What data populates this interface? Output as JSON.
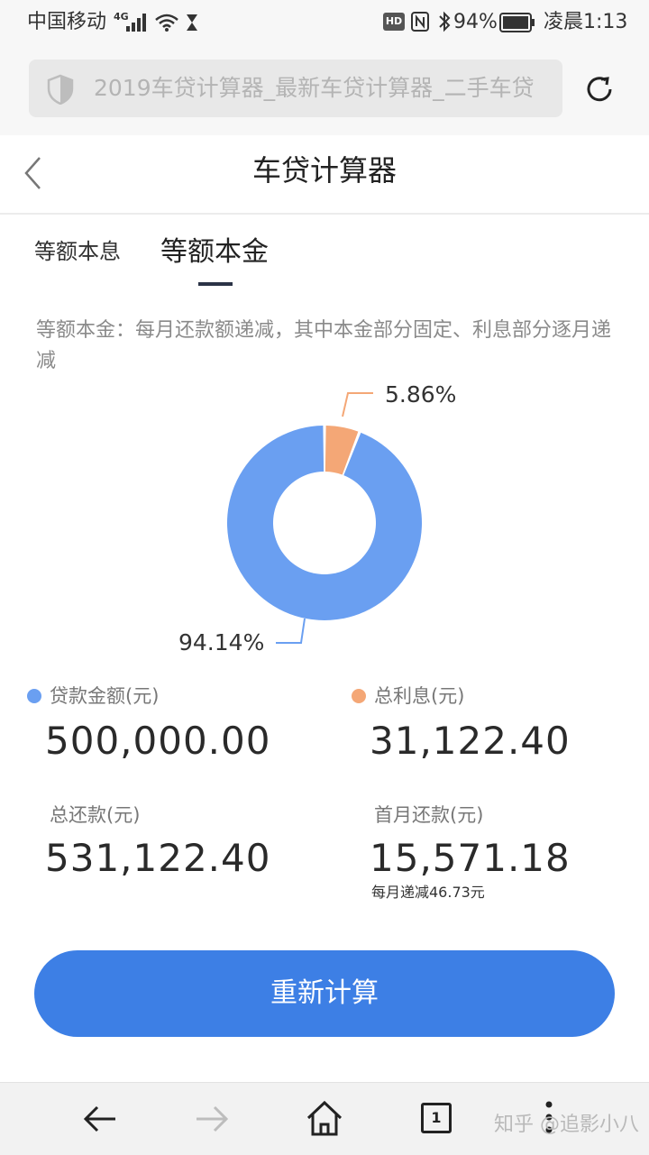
{
  "status_bar": {
    "carrier": "中国移动",
    "network": "4G",
    "hd_label": "HD",
    "battery": "94%",
    "time": "凌晨1:13"
  },
  "browser": {
    "address_text": "2019车贷计算器_最新车贷计算器_二手车贷",
    "tab_count": "1"
  },
  "header": {
    "title": "车贷计算器"
  },
  "tabs": [
    {
      "label": "等额本息",
      "active": false
    },
    {
      "label": "等额本金",
      "active": true
    }
  ],
  "description": "等额本金：每月还款额递减，其中本金部分固定、利息部分逐月递减",
  "chart_data": {
    "type": "pie",
    "style": "donut",
    "slices": [
      {
        "label": "贷款金额(元)",
        "value": 94.14,
        "display": "94.14%",
        "color": "#6a9ff1"
      },
      {
        "label": "总利息(元)",
        "value": 5.86,
        "display": "5.86%",
        "color": "#f4a776"
      }
    ]
  },
  "summary": {
    "loan_amount_label": "贷款金额(元)",
    "loan_amount": "500,000.00",
    "interest_label": "总利息(元)",
    "interest": "31,122.40",
    "total_label": "总还款(元)",
    "total": "531,122.40",
    "first_month_label": "首月还款(元)",
    "first_month": "15,571.18",
    "decrease_note": "每月递减46.73元"
  },
  "recalc_button": "重新计算",
  "watermark": "知乎 @追影小八",
  "colors": {
    "loan": "#6a9ff1",
    "interest": "#f4a776",
    "primary_button": "#3d7fe5"
  }
}
